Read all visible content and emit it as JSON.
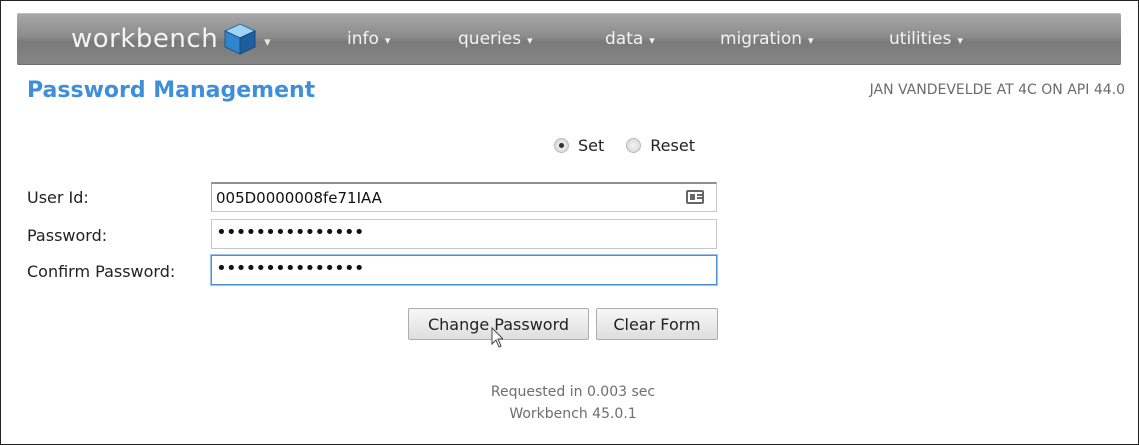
{
  "nav": {
    "brand": "workbench",
    "menus": [
      {
        "label": "info"
      },
      {
        "label": "queries"
      },
      {
        "label": "data"
      },
      {
        "label": "migration"
      },
      {
        "label": "utilities"
      }
    ]
  },
  "header": {
    "title": "Password Management",
    "user_info": "JAN VANDEVELDE AT 4C ON API 44.0"
  },
  "mode": {
    "options": [
      {
        "label": "Set",
        "selected": true
      },
      {
        "label": "Reset",
        "selected": false
      }
    ]
  },
  "form": {
    "user_id_label": "User Id:",
    "user_id_value": "005D0000008fe71IAA",
    "password_label": "Password:",
    "password_value": "•••••••••••••••",
    "confirm_label": "Confirm Password:",
    "confirm_value": "•••••••••••••••"
  },
  "buttons": {
    "change_password": "Change Password",
    "clear_form": "Clear Form"
  },
  "footer": {
    "timing": "Requested in 0.003 sec",
    "version": "Workbench 45.0.1"
  },
  "colors": {
    "accent": "#3f8fd8",
    "nav_bg": "#8c8c8c"
  }
}
